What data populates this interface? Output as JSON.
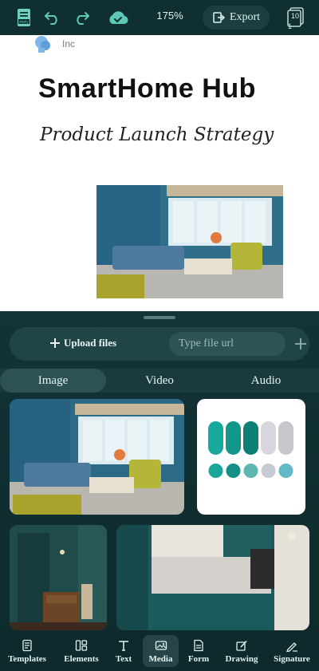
{
  "topbar": {
    "zoom": "175%",
    "export_label": "Export",
    "pages_count": "10",
    "pages_sub": "1",
    "icons": [
      "file-icon",
      "undo-icon",
      "redo-icon",
      "cloud-save-icon",
      "export-icon",
      "pages-icon"
    ]
  },
  "document": {
    "logo_text": "Inc",
    "title": "SmartHome Hub",
    "subtitle": "Product Launch Strategy"
  },
  "panel": {
    "upload_label": "Upload files",
    "url_placeholder": "Type file url",
    "tabs": [
      {
        "label": "Image",
        "active": true
      },
      {
        "label": "Video",
        "active": false
      },
      {
        "label": "Audio",
        "active": false
      }
    ]
  },
  "palette": {
    "colors": [
      "#16a99c",
      "#13968a",
      "#0e7f75",
      "#d6d6dc",
      "#c5c7cc"
    ],
    "circles": [
      "#1aa79a",
      "#138f86",
      "#5fb6b1",
      "#c8cad3",
      "#63b9c7"
    ]
  },
  "bottom_nav": [
    {
      "label": "Templates",
      "icon": "templates-icon",
      "active": false
    },
    {
      "label": "Elements",
      "icon": "elements-icon",
      "active": false
    },
    {
      "label": "Text",
      "icon": "text-icon",
      "active": false
    },
    {
      "label": "Media",
      "icon": "media-icon",
      "active": true
    },
    {
      "label": "Form",
      "icon": "form-icon",
      "active": false
    },
    {
      "label": "Drawing",
      "icon": "drawing-icon",
      "active": false
    },
    {
      "label": "Signature",
      "icon": "signature-icon",
      "active": false
    }
  ]
}
